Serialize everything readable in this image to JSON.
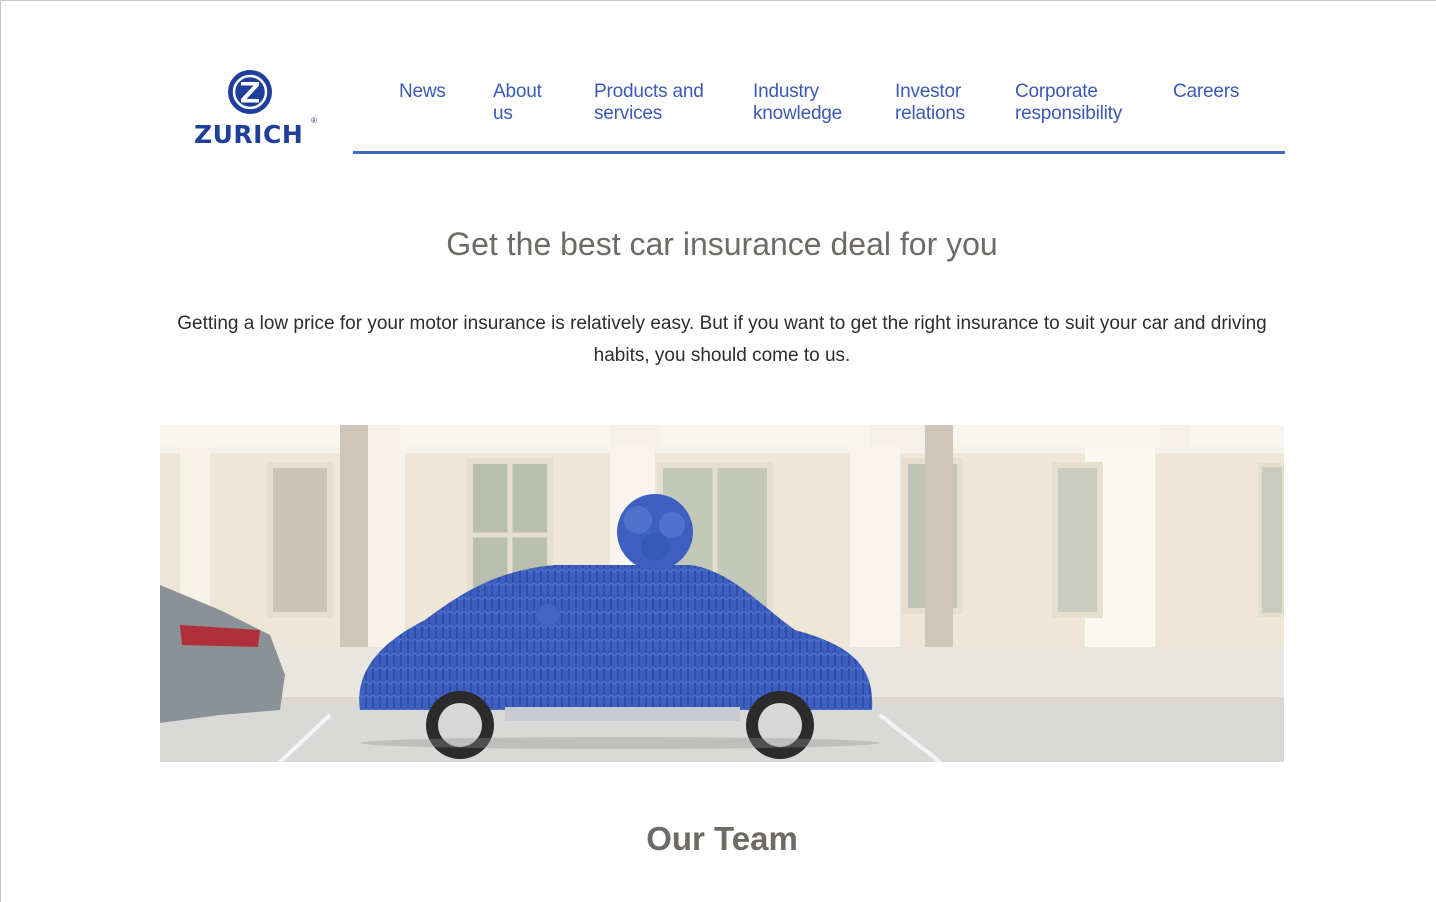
{
  "brand": {
    "name": "ZURICH",
    "registered_mark": "®",
    "color": "#1f3f9a",
    "logo_icon": "zurich-z-icon"
  },
  "nav": {
    "accent_color": "#3f67c4",
    "items": [
      {
        "label": "News"
      },
      {
        "label": "About us"
      },
      {
        "label": "Products and services"
      },
      {
        "label": "Industry knowledge"
      },
      {
        "label": "Investor relations"
      },
      {
        "label": "Corporate responsibility"
      },
      {
        "label": "Careers"
      }
    ]
  },
  "main": {
    "headline": "Get the best car insurance deal for you",
    "intro": "Getting a low price for your motor insurance is relatively easy. But if you want to get the right insurance to suit your car and driving habits, you should come to us.",
    "team_title": "Our Team"
  }
}
